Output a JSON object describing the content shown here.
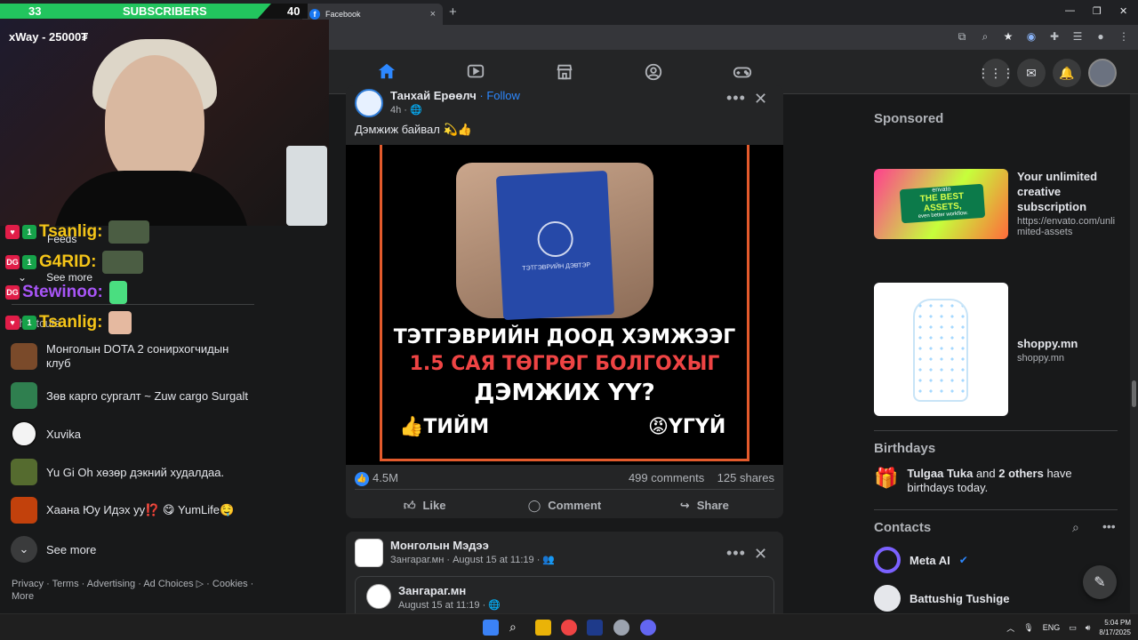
{
  "browser": {
    "tab_title": "Facebook",
    "tab_favicon": "f",
    "new_tab": "+",
    "close_tab": "×"
  },
  "stream": {
    "sub_left": "33",
    "sub_label": "SUBSCRIBERS",
    "sub_right": "40",
    "donation": "xWay - 25000₮",
    "chat": [
      {
        "user": "Tsanlig:",
        "badges": [
          "1ST"
        ],
        "color": "#f5c518"
      },
      {
        "user": "G4RID:",
        "badges": [
          "DG",
          "1ST"
        ],
        "color": "#f5c518"
      },
      {
        "user": "Stewinoo:",
        "badges": [
          "DG"
        ],
        "color": "#a855f7"
      },
      {
        "user": "Tsanlig:",
        "badges": [
          "1ST"
        ],
        "color": "#f5c518"
      }
    ]
  },
  "sidebar": {
    "feeds_label": "Feeds",
    "see_more_top": "See more",
    "shortcuts_label": "Shortcuts",
    "items": [
      {
        "label": "Монголын DOTA 2 сонирхогчидын клуб",
        "color": "#7a4a2a"
      },
      {
        "label": "Зөв карго сургалт ~ Zuw cargo Surgalt",
        "color": "#2f7f4f"
      },
      {
        "label": "Xuvika",
        "color": "#ffffff"
      },
      {
        "label": "Yu Gi Oh хөзөр дэкний худалдаа.",
        "color": "#556b2f"
      },
      {
        "label": "Хаана Юу Идэх уу⁉️ 😋 YumLife🤤",
        "color": "#c2410c"
      }
    ],
    "see_more_bottom": "See more",
    "footer": "Privacy · Terms · Advertising · Ad Choices ▷ · Cookies · More"
  },
  "post1": {
    "author": "Танхай Ерөөлч",
    "follow": "· Follow",
    "time": "4h · 🌐",
    "caption": "Дэмжиж байвал 💫👍",
    "image_text": {
      "line1": "ТЭТГЭВРИЙН ДООД ХЭМЖЭЭГ",
      "line2": "1.5 САЯ ТӨГРӨГ БОЛГОХЫГ",
      "line3": "ДЭМЖИХ ҮҮ?",
      "yes": "👍ТИЙМ",
      "no": "😡ҮГҮЙ",
      "passport": "ТЭТГЭВРИЙН ДЭВТЭР"
    },
    "reactions": "4.5M",
    "comments": "499 comments",
    "shares": "125 shares",
    "like": "Like",
    "comment": "Comment",
    "share": "Share"
  },
  "post2": {
    "author": "Монголын Мэдээ",
    "meta": "Зангараг.мн · August 15 at 11:19 · 👥",
    "shared_author": "Зангараг.мн",
    "shared_meta": "August 15 at 11:19 · 🌐"
  },
  "right": {
    "sponsored": "Sponsored",
    "ads": [
      {
        "title": "Your unlimited creative subscription",
        "url": "https://envato.com/unlimited-assets",
        "img_text": "THE BEST ASSETS,",
        "img_sub": "even better workflow.",
        "brand": "envato"
      },
      {
        "title": "shoppy.mn",
        "url": "shoppy.mn"
      }
    ],
    "birthdays": "Birthdays",
    "birthday_text_name": "Tulgaa Tuka",
    "birthday_text_and": " and ",
    "birthday_text_others": "2 others",
    "birthday_text_rest": " have birthdays today.",
    "contacts": "Contacts",
    "contact_list": [
      {
        "name": "Meta AI"
      },
      {
        "name": "Battushig Tushige"
      }
    ]
  },
  "taskbar": {
    "lang": "ENG",
    "time": "5:04 PM",
    "date": "8/17/2025"
  }
}
